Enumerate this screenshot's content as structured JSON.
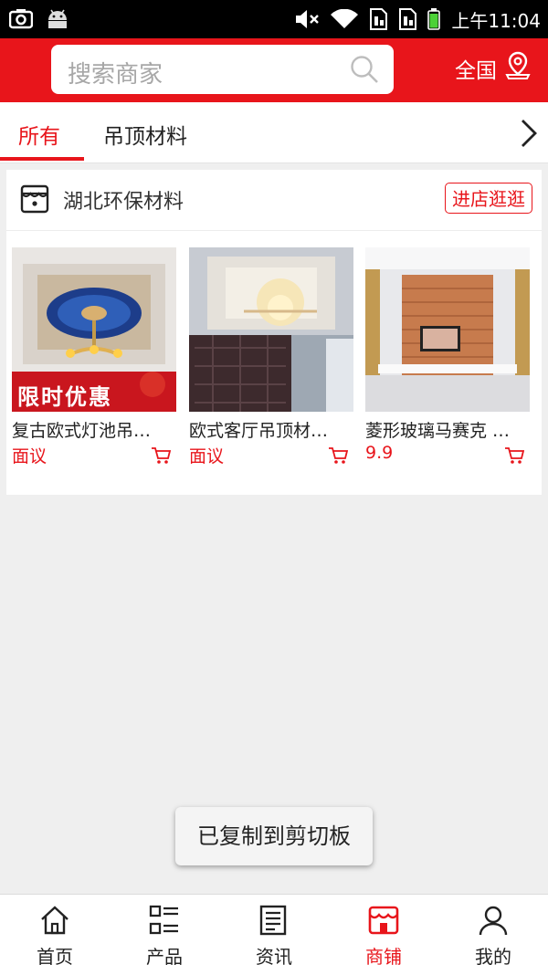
{
  "status_bar": {
    "time": "上午11:04"
  },
  "header": {
    "search_placeholder": "搜索商家",
    "region_label": "全国"
  },
  "tabs": [
    {
      "label": "所有",
      "active": true
    },
    {
      "label": "吊顶材料",
      "active": false
    }
  ],
  "shop": {
    "name": "湖北环保材料",
    "enter_button": "进店逛逛",
    "products": [
      {
        "name": "复古欧式灯池吊…",
        "price": "面议",
        "banner_text": "限时优惠"
      },
      {
        "name": "欧式客厅吊顶材…",
        "price": "面议"
      },
      {
        "name": "菱形玻璃马赛克 …",
        "price": "9.9"
      }
    ]
  },
  "toast": "已复制到剪切板",
  "bottom_nav": [
    {
      "label": "首页",
      "icon": "home-icon"
    },
    {
      "label": "产品",
      "icon": "grid-list-icon"
    },
    {
      "label": "资讯",
      "icon": "news-icon"
    },
    {
      "label": "商铺",
      "icon": "shop-icon",
      "active": true
    },
    {
      "label": "我的",
      "icon": "user-icon"
    }
  ],
  "colors": {
    "brand_red": "#e8151b"
  }
}
